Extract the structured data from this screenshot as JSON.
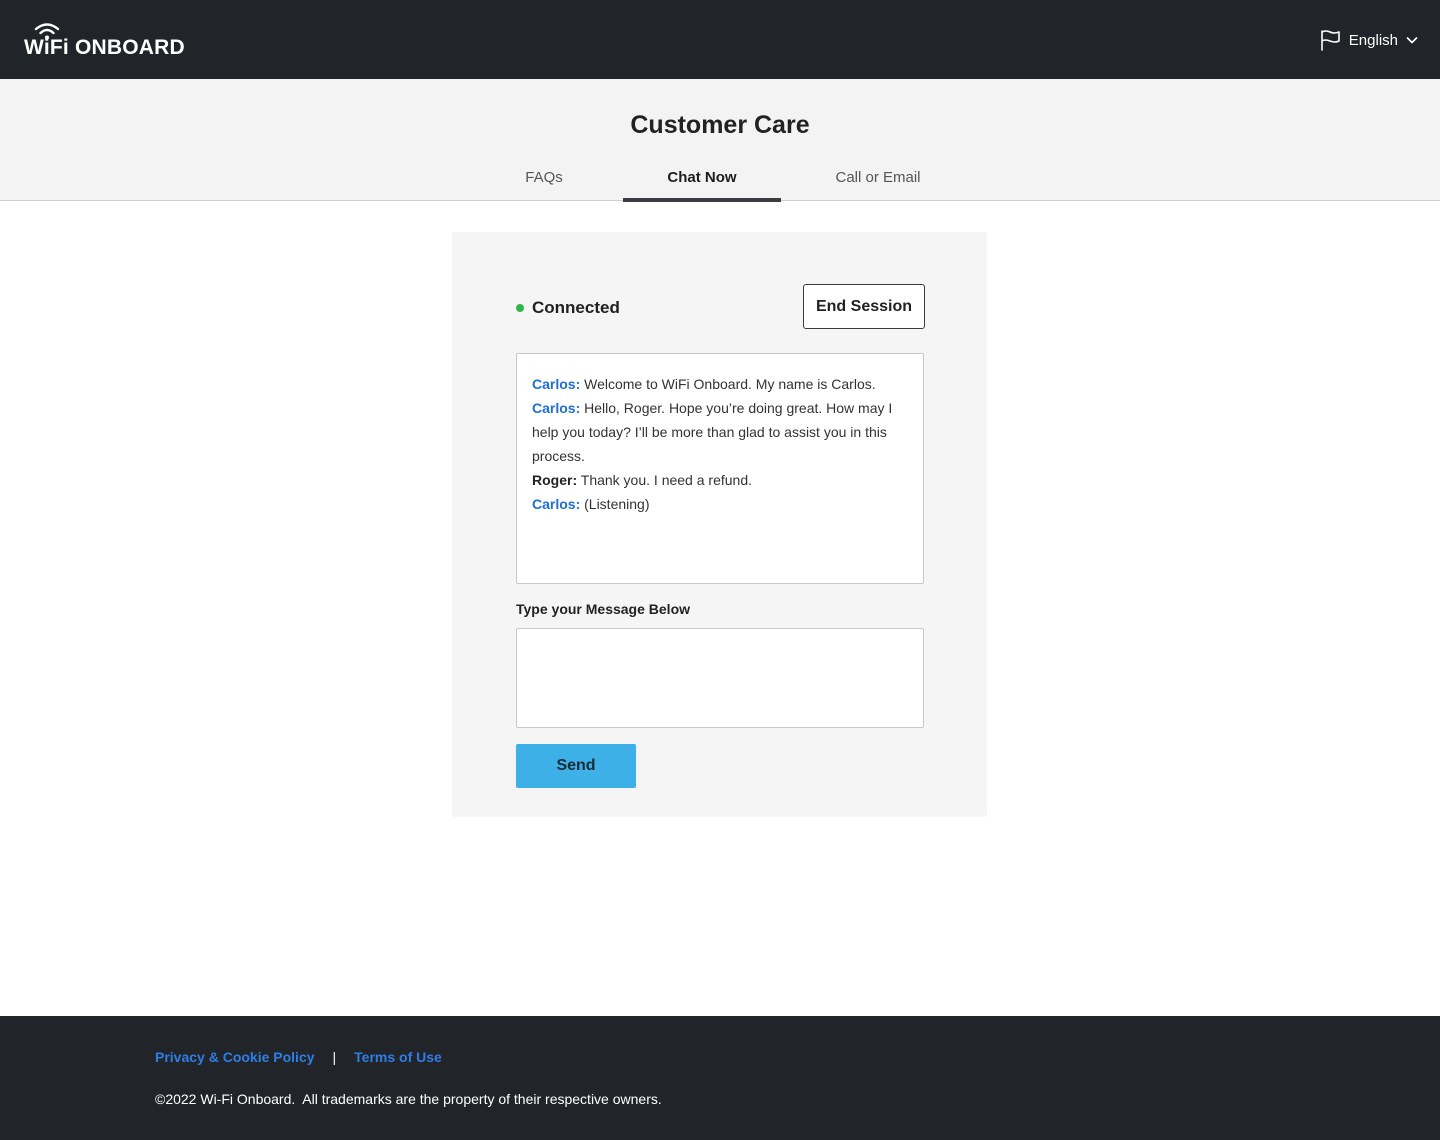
{
  "header": {
    "logo_text": "WiFi ONBOARD",
    "language": {
      "label": "English",
      "icon": "flag-icon",
      "dropdown_icon": "chevron-down-icon"
    }
  },
  "page": {
    "title": "Customer Care",
    "tabs": [
      {
        "label": "FAQs",
        "active": false
      },
      {
        "label": "Chat Now",
        "active": true
      },
      {
        "label": "Call or Email",
        "active": false
      }
    ]
  },
  "chat": {
    "status": {
      "label": "Connected",
      "color": "#2eb84b"
    },
    "end_session_label": "End Session",
    "messages": [
      {
        "speaker": "Carlos:",
        "role": "agent",
        "text": " Welcome to WiFi Onboard. My name is Carlos."
      },
      {
        "speaker": "Carlos:",
        "role": "agent",
        "text": " Hello, Roger. Hope you’re doing great. How may I help you today? I’ll be more than glad to assist you in this process."
      },
      {
        "speaker": "Roger:",
        "role": "user",
        "text": " Thank you. I need a refund."
      },
      {
        "speaker": "Carlos:",
        "role": "agent",
        "text": " (Listening)"
      }
    ],
    "compose_label": "Type your Message Below",
    "compose_value": "",
    "send_label": "Send"
  },
  "footer": {
    "links": [
      "Privacy & Cookie Policy",
      "Terms of Use"
    ],
    "separator": "|",
    "copyright": "©2022 Wi-Fi Onboard.  All trademarks are the property of their respective owners."
  },
  "colors": {
    "topbar": "#212429",
    "accent_blue": "#1f6fd6",
    "send_button": "#3db1e7",
    "status_green": "#2eb84b"
  }
}
